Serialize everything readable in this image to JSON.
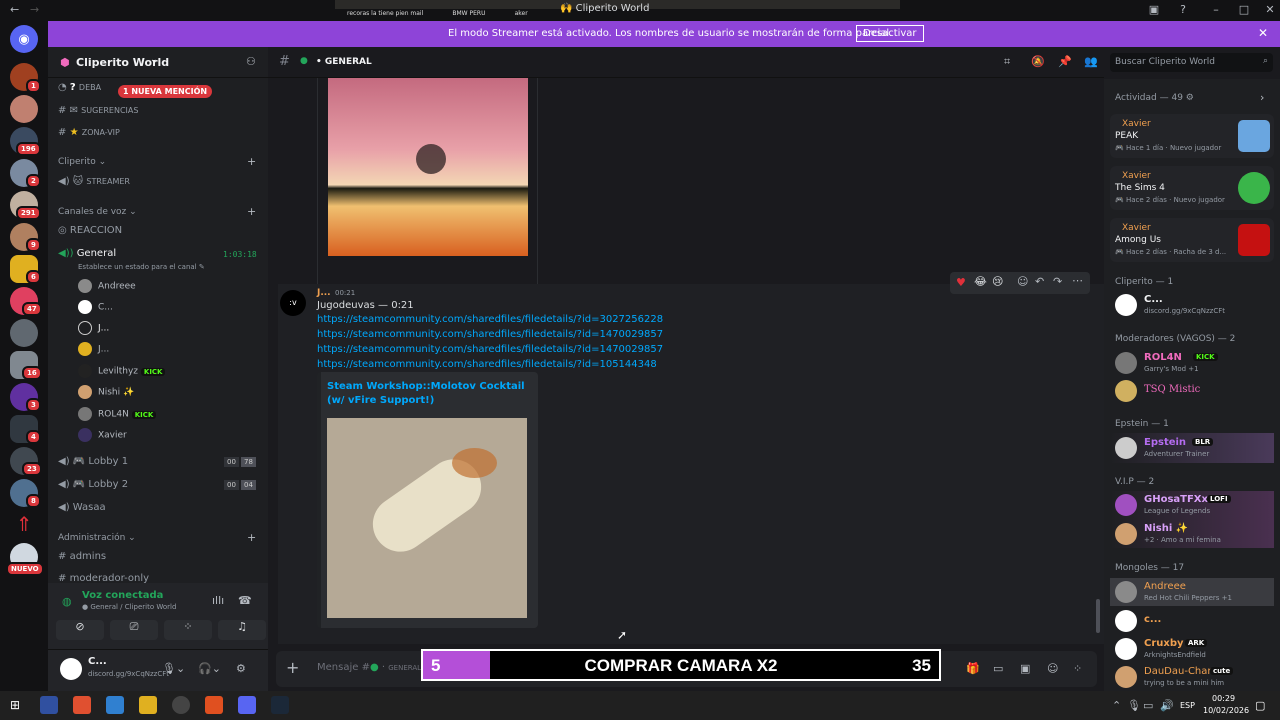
{
  "titlebar": {
    "title": "🙌 Cliperito World",
    "stream_text": [
      "recoras la tiene pien mail",
      "BMW PERU",
      "aker"
    ]
  },
  "banner": {
    "message": "El modo Streamer está activado. Los nombres de usuario se mostrarán de forma parcial.",
    "button": "Desactivar"
  },
  "servers": {
    "badges": [
      "1",
      "196",
      "2",
      "291",
      "9",
      "6",
      "47",
      "16",
      "3",
      "4",
      "23",
      "8",
      "NUEVO"
    ]
  },
  "guild": {
    "name": "Cliperito World"
  },
  "channels": {
    "mention_pill": "1 NUEVA MENCIÓN",
    "text": [
      {
        "icon": "?",
        "name": "DEBA"
      },
      {
        "icon": "✉",
        "name": "SUGERENCIAS"
      },
      {
        "icon": "★",
        "name": "ZONA-VIP"
      }
    ],
    "cat_cliperito": "Cliperito",
    "streamer": "STREAMER",
    "cat_voice": "Canales de voz",
    "reaccion": "REACCION",
    "general": "General",
    "general_time": "1:03:18",
    "general_status": "Establece un estado para el canal",
    "voice_users": [
      "Andreee",
      "C...",
      "J...",
      "J...",
      "Levilthyz",
      "Nishi ✨",
      "ROL4N",
      "Xavier"
    ],
    "kick": "KICK",
    "lobby1": "Lobby 1",
    "lobby1_a": "00",
    "lobby1_b": "78",
    "lobby2": "Lobby 2",
    "lobby2_a": "00",
    "lobby2_b": "04",
    "wasaa": "Wasaa",
    "cat_admin": "Administración",
    "admins": "admins",
    "moderador": "moderador-only"
  },
  "voice_panel": {
    "status": "Voz conectada",
    "location": "General / Cliperito World"
  },
  "user": {
    "name": "C...",
    "status": "discord.gg/9xCqNzzCFt"
  },
  "channel_header": {
    "name": "GENERAL"
  },
  "search": {
    "placeholder": "Buscar Cliperito World"
  },
  "message": {
    "author": "J...",
    "time": "00:21",
    "text": "Jugodeuvas — 0:21",
    "avatar": ":v",
    "links": [
      "https://steamcommunity.com/sharedfiles/filedetails/?id=3027256228",
      "https://steamcommunity.com/sharedfiles/filedetails/?id=1470029857",
      "https://steamcommunity.com/sharedfiles/filedetails/?id=1470029857",
      "https://steamcommunity.com/sharedfiles/filedetails/?id=105144348"
    ],
    "embed_title": "Steam Workshop::Molotov Cocktail (w/ vFire Support!)"
  },
  "composer": {
    "placeholder": "Mensaje #",
    "channel": "GENERAL"
  },
  "overlay": {
    "left": "5",
    "title": "COMPRAR CAMARA X2",
    "right": "35",
    "progress": 0.13
  },
  "members": {
    "activity_header": "Actividad — 49",
    "activities": [
      {
        "user": "Xavier",
        "game": "PEAK",
        "meta": "Hace 1 día",
        "tag": "Nuevo jugador",
        "color": "#6aa6e0"
      },
      {
        "user": "Xavier",
        "game": "The Sims 4",
        "meta": "Hace 2 días",
        "tag": "Nuevo jugador",
        "color": "#3ab54a"
      },
      {
        "user": "Xavier",
        "game": "Among Us",
        "meta": "Hace 2 días",
        "tag": "Racha de 3 d...",
        "color": "#c51111"
      }
    ],
    "groups": [
      {
        "header": "Cliperito — 1",
        "items": [
          {
            "name": "C...",
            "status": "discord.gg/9xCqNzzCFt",
            "color": "#f2f3f5"
          }
        ]
      },
      {
        "header": "Moderadores (VAGOS) — 2",
        "items": [
          {
            "name": "ROL4N",
            "status": "Garry's Mod +1",
            "color": "#f06bbd",
            "badge": "KICK"
          },
          {
            "name": "TSQ Mistic",
            "status": "",
            "color": "#f06bbd"
          }
        ]
      },
      {
        "header": "Epstein — 1",
        "items": [
          {
            "name": "Epstein",
            "status": "Adventurer Trainer",
            "color": "#b46cf0",
            "badge": "BLR"
          }
        ]
      },
      {
        "header": "V.I.P — 2",
        "items": [
          {
            "name": "GHosaTFXx",
            "status": "League of Legends",
            "color": "#d8a0f8",
            "badge": "LOFI"
          },
          {
            "name": "Nishi ✨",
            "status": "+2 · Amo a mi femina",
            "color": "#d8a0f8"
          }
        ]
      },
      {
        "header": "Mongoles — 17",
        "items": [
          {
            "name": "Andreee",
            "status": "Red Hot Chili Peppers +1",
            "color": "#f0a050"
          },
          {
            "name": "c...",
            "status": "",
            "color": "#f0a050"
          },
          {
            "name": "Cruxby",
            "status": "ArknightsEndfield",
            "color": "#f0a050",
            "badge": "ARK"
          },
          {
            "name": "DauDau-Chan",
            "status": "trying to be a mini him",
            "color": "#f0a050",
            "badge": "cute"
          }
        ]
      }
    ]
  },
  "taskbar": {
    "lang": "ESP",
    "time": "00:29",
    "date": "10/02/2026"
  }
}
